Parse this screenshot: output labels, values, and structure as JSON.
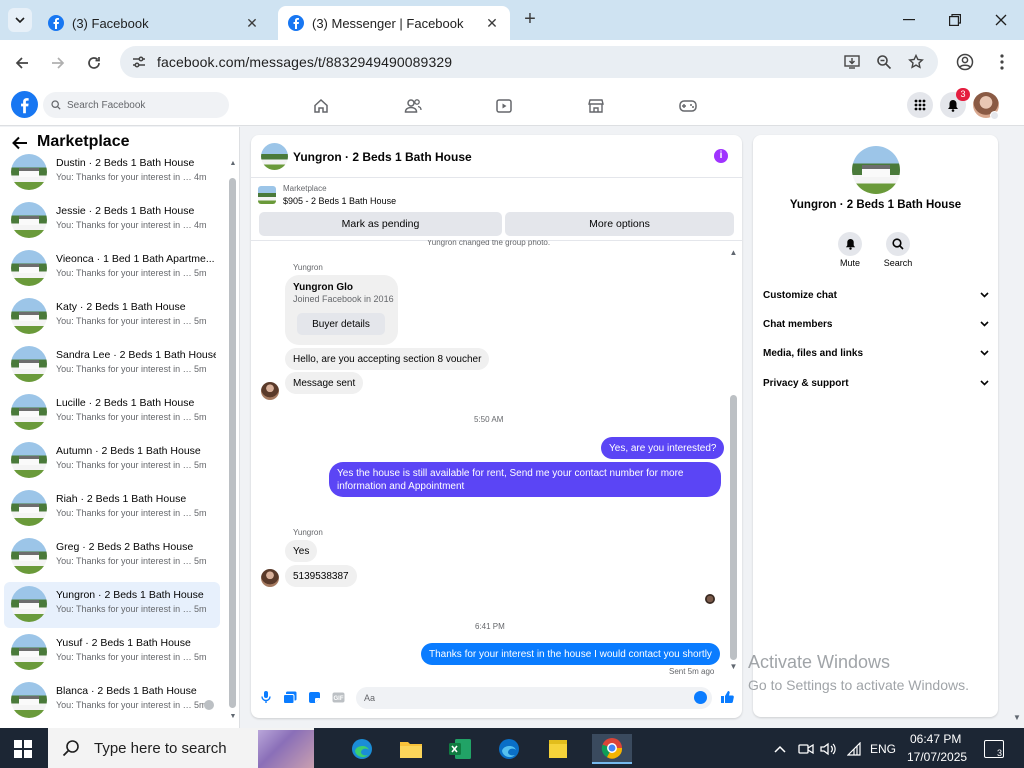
{
  "browser": {
    "tabs": [
      {
        "title": "(3) Facebook"
      },
      {
        "title": "(3) Messenger | Facebook"
      }
    ],
    "url": "facebook.com/messages/t/8832949490089329"
  },
  "fbnav": {
    "search_placeholder": "Search Facebook",
    "notification_count": "3"
  },
  "sidebar": {
    "title": "Marketplace",
    "threads": [
      {
        "name": "Dustin · 2 Beds 1 Bath House",
        "snippet": "You: Thanks for your interest in the house I would contact you shortly",
        "time": "4m"
      },
      {
        "name": "Jessie · 2 Beds 1 Bath House",
        "snippet": "You: Thanks for your interest in the house I would contact you shortly",
        "time": "4m"
      },
      {
        "name": "Vieonca · 1 Bed 1 Bath Apartme...",
        "snippet": "You: Thanks for your interest in the house I would contact you shortly",
        "time": "5m"
      },
      {
        "name": "Katy · 2 Beds 1 Bath House",
        "snippet": "You: Thanks for your interest in the house I would contact you shortly",
        "time": "5m"
      },
      {
        "name": "Sandra Lee · 2 Beds 1 Bath House",
        "snippet": "You: Thanks for your interest in the house I would contact you shortly",
        "time": "5m"
      },
      {
        "name": "Lucille · 2 Beds 1 Bath House",
        "snippet": "You: Thanks for your interest in the house I would contact you shortly",
        "time": "5m"
      },
      {
        "name": "Autumn · 2 Beds 1 Bath House",
        "snippet": "You: Thanks for your interest in the house I would contact you shortly",
        "time": "5m"
      },
      {
        "name": "Riah · 2 Beds 1 Bath House",
        "snippet": "You: Thanks for your interest in the house I would contact you shortly",
        "time": "5m"
      },
      {
        "name": "Greg · 2 Beds 2 Baths House",
        "snippet": "You: Thanks for your interest in the house I would contact you shortly",
        "time": "5m"
      },
      {
        "name": "Yungron · 2 Beds 1 Bath House",
        "snippet": "You: Thanks for your interest in the house I would contact you shortly",
        "time": "5m"
      },
      {
        "name": "Yusuf · 2 Beds 1 Bath House",
        "snippet": "You: Thanks for your interest in the house I would contact you shortly",
        "time": "5m"
      },
      {
        "name": "Blanca · 2 Beds 1 Bath House",
        "snippet": "You: Thanks for your interest in the house I would contact you shortly",
        "time": "5m"
      }
    ]
  },
  "chat": {
    "title": "Yungron · 2 Beds 1 Bath House",
    "marketplace_label": "Marketplace",
    "listing": "$905 - 2 Beds 1 Bath House",
    "mark_pending": "Mark as pending",
    "more_options": "More options",
    "changed_photo": "Yungron changed the group photo.",
    "sender_label": "Yungron",
    "buyer_name": "Yungron Glo",
    "buyer_sub": "Joined Facebook in 2016",
    "buyer_details": "Buyer details",
    "msg1": "Hello, are you accepting section 8 voucher",
    "msg2": "Message sent",
    "time1": "5:50 AM",
    "out1": "Yes, are you interested?",
    "out2": "Yes the house is still available for rent, Send me your contact number for more information and Appointment",
    "sender_label2": "Yungron",
    "msg3": "Yes",
    "msg4": "5139538387",
    "time2": "6:41 PM",
    "out3": "Thanks for your interest in the house I would contact you shortly",
    "sent": "Sent 5m ago",
    "composer_placeholder": "Aa"
  },
  "panel": {
    "title": "Yungron · 2 Beds 1 Bath House",
    "mute": "Mute",
    "search": "Search",
    "rows": [
      "Customize chat",
      "Chat members",
      "Media, files and links",
      "Privacy & support"
    ]
  },
  "watermark": {
    "line1": "Activate Windows",
    "line2": "Go to Settings to activate Windows."
  },
  "taskbar": {
    "search": "Type here to search",
    "lang": "ENG",
    "time": "06:47 PM",
    "date": "17/07/2025",
    "notifications": "3"
  }
}
